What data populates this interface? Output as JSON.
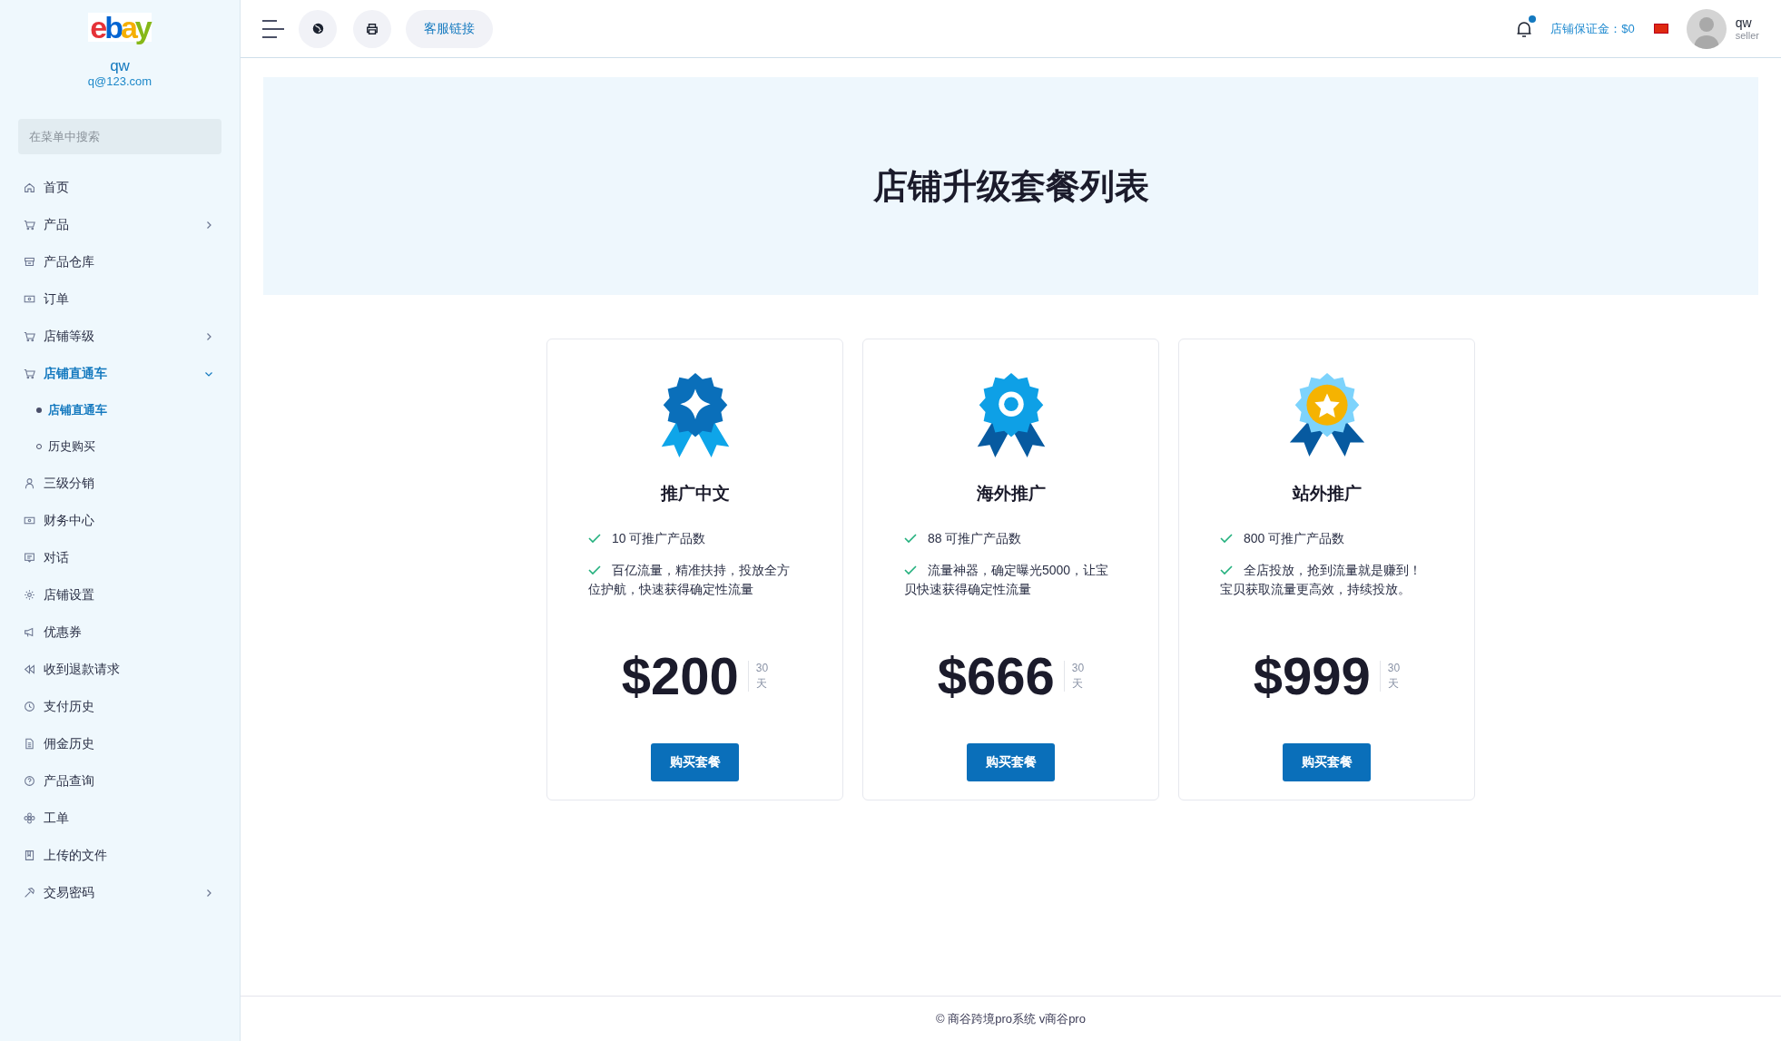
{
  "sidebar": {
    "logo": "ebay",
    "user_name": "qw",
    "user_email": "q@123.com",
    "search": {
      "placeholder": "在菜单中搜索"
    },
    "items": [
      {
        "label": "首页",
        "selected": false
      },
      {
        "label": "产品",
        "selected": false,
        "expanded": false
      },
      {
        "label": "产品仓库",
        "selected": false
      },
      {
        "label": "订单",
        "selected": false
      },
      {
        "label": "店铺等级",
        "selected": false,
        "expanded": false
      },
      {
        "label": "店铺直通车",
        "selected": true,
        "expanded": true,
        "children": [
          {
            "label": "店铺直通车",
            "selected": true
          },
          {
            "label": "历史购买",
            "selected": false
          }
        ]
      },
      {
        "label": "三级分销",
        "selected": false
      },
      {
        "label": "财务中心",
        "selected": false
      },
      {
        "label": "对话",
        "selected": false
      },
      {
        "label": "店铺设置",
        "selected": false
      },
      {
        "label": "优惠券",
        "selected": false
      },
      {
        "label": "收到退款请求",
        "selected": false
      },
      {
        "label": "支付历史",
        "selected": false
      },
      {
        "label": "佣金历史",
        "selected": false
      },
      {
        "label": "产品查询",
        "selected": false
      },
      {
        "label": "工单",
        "selected": false
      },
      {
        "label": "上传的文件",
        "selected": false
      },
      {
        "label": "交易密码",
        "selected": false,
        "expanded": false
      }
    ]
  },
  "topbar": {
    "service_link": "客服链接",
    "notification_dot": true,
    "deposit": "店铺保证金：$0",
    "user_name": "qw",
    "user_role": "seller"
  },
  "page_title": "店铺升级套餐列表",
  "plans": [
    {
      "title": "推广中文",
      "features": [
        "10 可推广产品数",
        "百亿流量，精准扶持，投放全方位护航，快速获得确定性流量"
      ],
      "price": "$200",
      "period_number": "30",
      "period_unit": "天",
      "button": "购买套餐"
    },
    {
      "title": "海外推广",
      "features": [
        "88 可推广产品数",
        "流量神器，确定曝光5000，让宝贝快速获得确定性流量"
      ],
      "price": "$666",
      "period_number": "30",
      "period_unit": "天",
      "button": "购买套餐"
    },
    {
      "title": "站外推广",
      "features": [
        "800 可推广产品数",
        "全店投放，抢到流量就是赚到！宝贝获取流量更高效，持续投放。"
      ],
      "price": "$999",
      "period_number": "30",
      "period_unit": "天",
      "button": "购买套餐"
    }
  ],
  "footer": "© 商谷跨境pro系统 v商谷pro"
}
